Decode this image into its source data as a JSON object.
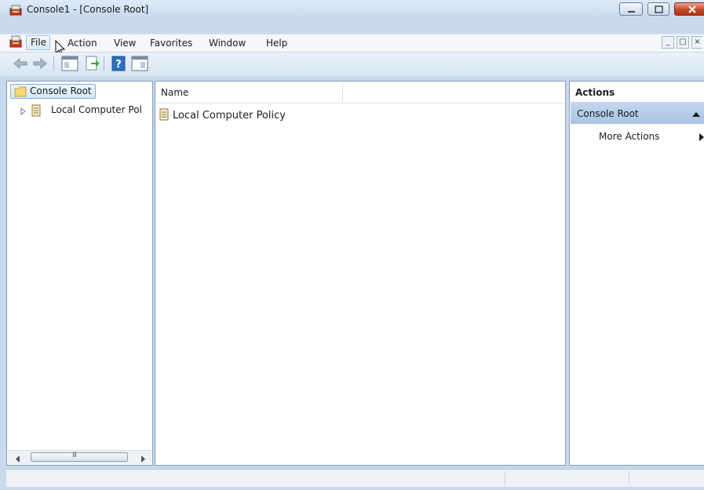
{
  "window": {
    "title": "Console1 - [Console Root]"
  },
  "menu": {
    "items": [
      "File",
      "Action",
      "View",
      "Favorites",
      "Window",
      "Help"
    ]
  },
  "toolbar": {
    "icons": [
      "back-arrow-icon",
      "forward-arrow-icon",
      "show-hide-console-tree-icon",
      "export-list-icon",
      "help-icon",
      "show-hide-action-pane-icon"
    ]
  },
  "tree": {
    "root_label": "Console Root",
    "child_label": "Local Computer Pol",
    "scroll_grip": "III"
  },
  "list": {
    "column_name": "Name",
    "rows": [
      "Local Computer Policy"
    ]
  },
  "actions": {
    "header": "Actions",
    "group_label": "Console Root",
    "items": [
      "More Actions"
    ]
  },
  "colors": {
    "accent": "#c6d8ee",
    "selection": "#d5e8fb",
    "close_button": "#c7472c"
  }
}
